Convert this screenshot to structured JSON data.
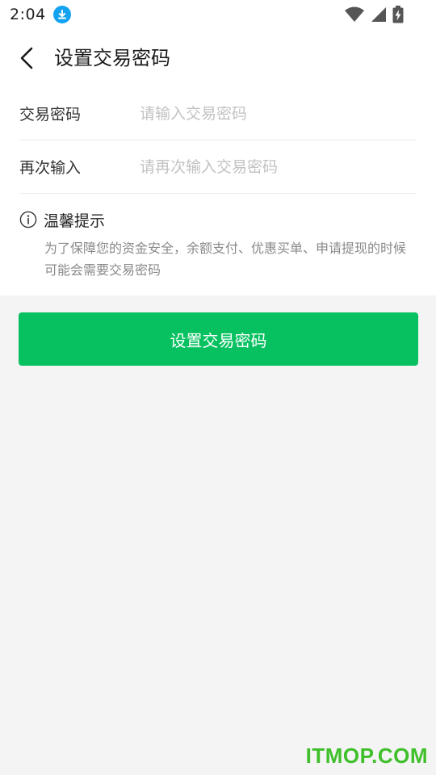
{
  "status_bar": {
    "time": "2:04",
    "download_icon": "download-icon",
    "wifi_icon": "wifi-icon",
    "signal_icon": "signal-icon",
    "battery_icon": "battery-charging-icon"
  },
  "header": {
    "back_icon": "chevron-left-icon",
    "title": "设置交易密码"
  },
  "form": {
    "password": {
      "label": "交易密码",
      "placeholder": "请输入交易密码",
      "value": ""
    },
    "confirm": {
      "label": "再次输入",
      "placeholder": "请再次输入交易密码",
      "value": ""
    }
  },
  "tip": {
    "icon": "info-icon",
    "title": "温馨提示",
    "text": "为了保障您的资金安全，余额支付、优惠买单、申请提现的时候可能会需要交易密码"
  },
  "actions": {
    "submit_label": "设置交易密码"
  },
  "watermark": "ITMOP.COM",
  "colors": {
    "accent": "#07c160",
    "background": "#f4f4f4",
    "placeholder": "#c2c2c2",
    "download_badge": "#13a3f0"
  }
}
